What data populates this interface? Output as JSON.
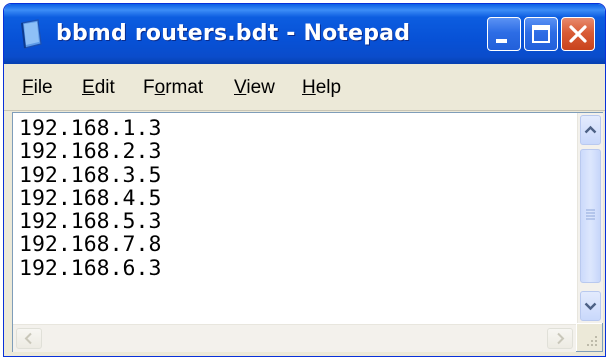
{
  "window": {
    "title": "bbmd routers.bdt - Notepad",
    "app_icon": "notepad-icon",
    "controls": {
      "minimize": "minimize-icon",
      "maximize": "maximize-icon",
      "close": "close-icon"
    }
  },
  "menubar": {
    "items": [
      {
        "label_u": "F",
        "label_rest": "ile",
        "label": "File"
      },
      {
        "label_u": "E",
        "label_rest": "dit",
        "label": "Edit"
      },
      {
        "label_pre": "F",
        "label_u": "o",
        "label_rest": "rmat",
        "label": "Format"
      },
      {
        "label_u": "V",
        "label_rest": "iew",
        "label": "View"
      },
      {
        "label_u": "H",
        "label_rest": "elp",
        "label": "Help"
      }
    ]
  },
  "editor": {
    "lines": [
      "192.168.1.3",
      "192.168.2.3",
      "192.168.3.5",
      "192.168.4.5",
      "192.168.5.3",
      "192.168.7.8",
      "192.168.6.3"
    ]
  },
  "colors": {
    "titlebar": "#0751D6",
    "close_button": "#D95C36",
    "chrome": "#ECE9D8"
  }
}
